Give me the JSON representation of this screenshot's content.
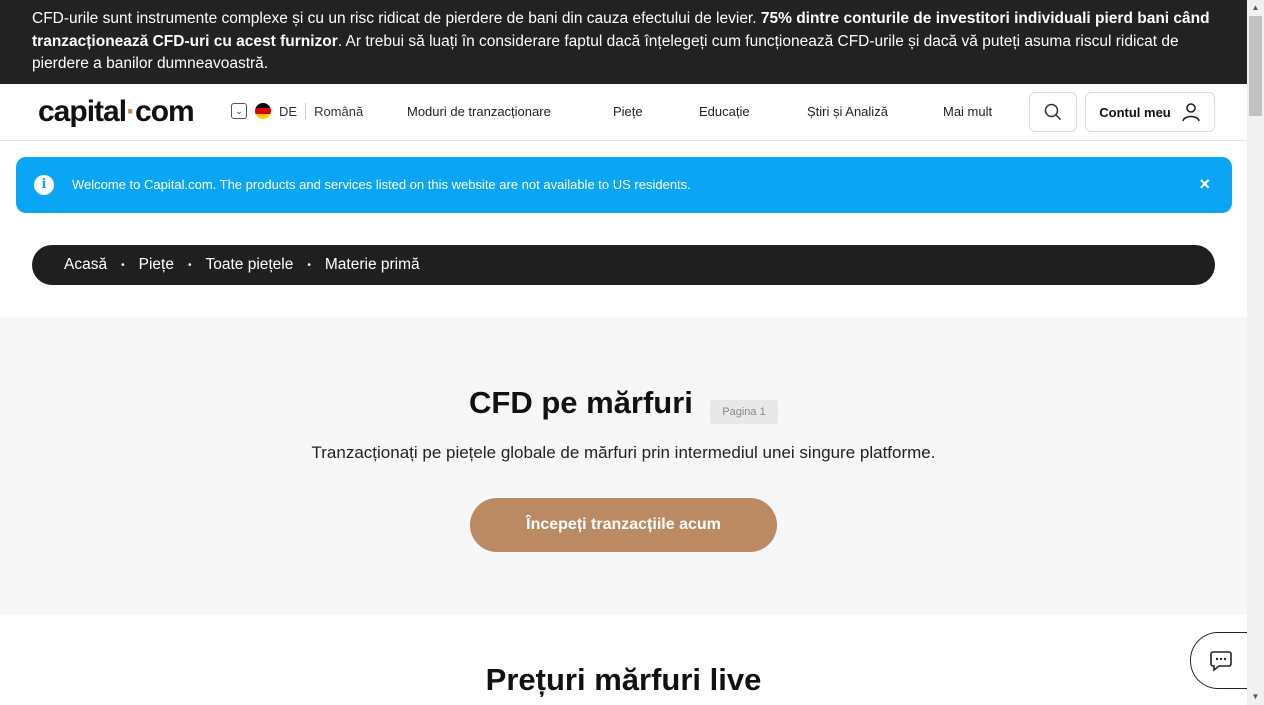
{
  "risk_warning": {
    "part1": "CFD-urile sunt instrumente complexe și cu un risc ridicat de pierdere de bani din cauza efectului de levier. ",
    "bold": "75% dintre conturile de investitori individuali pierd bani când tranzacționează CFD-uri cu acest furnizor",
    "part2": ". Ar trebui să luați în considerare faptul dacă înțelegeți cum funcționează CFD-urile și dacă vă puteți asuma riscul ridicat de pierdere a banilor dumneavoastră."
  },
  "header": {
    "logo_left": "capital",
    "logo_dot": "·",
    "logo_right": "com",
    "country_code": "DE",
    "language": "Română",
    "nav": [
      "Moduri de tranzacționare",
      "Piețe",
      "Educație",
      "Știri și Analiză",
      "Mai mult"
    ],
    "account_label": "Contul meu"
  },
  "notice": {
    "icon": "info-icon",
    "text": "Welcome to Capital.com. The products and services listed on this website are not available to US residents.",
    "close": "×",
    "color": "#0aa6f5"
  },
  "breadcrumb": [
    "Acasă",
    "Piețe",
    "Toate piețele",
    "Materie primă"
  ],
  "hero": {
    "title": "CFD pe mărfuri",
    "page_badge": "Pagina 1",
    "subtitle": "Tranzacționați pe piețele globale de mărfuri prin intermediul unei singure platforme.",
    "cta": "Începeți tranzacțiile acum",
    "cta_color": "#bb8a62"
  },
  "section": {
    "title": "Prețuri mărfuri live"
  }
}
